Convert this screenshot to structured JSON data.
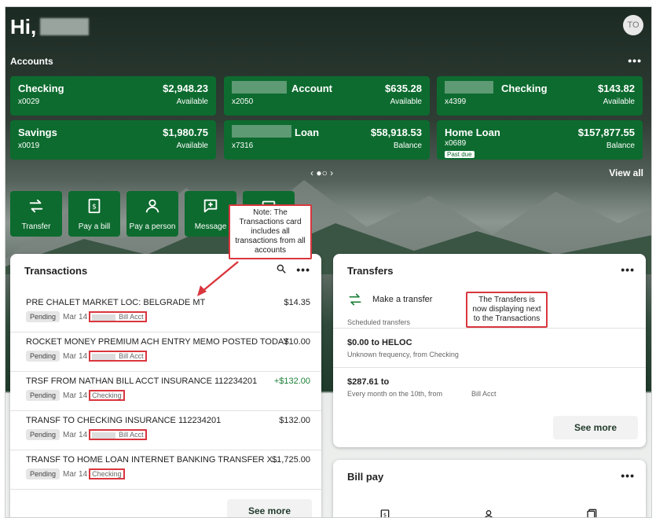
{
  "greeting": "Hi,",
  "avatar_initials": "TO",
  "accounts": {
    "label": "Accounts",
    "more": "•••",
    "items": [
      {
        "name": "Checking",
        "number": "x0029",
        "amount": "$2,948.23",
        "sub": "Available"
      },
      {
        "name": "Account",
        "number": "x2050",
        "amount": "$635.28",
        "sub": "Available"
      },
      {
        "name": "Checking",
        "number": "x4399",
        "amount": "$143.82",
        "sub": "Available"
      },
      {
        "name": "Savings",
        "number": "x0019",
        "amount": "$1,980.75",
        "sub": "Available"
      },
      {
        "name": "Loan",
        "number": "x7316",
        "amount": "$58,918.53",
        "sub": "Balance"
      },
      {
        "name": "Home Loan",
        "number": "x0689",
        "amount": "$157,877.55",
        "sub": "Balance",
        "badge": "Past due"
      }
    ],
    "pager": "‹ ●○ ›",
    "view_all": "View all"
  },
  "quick_actions": [
    {
      "label": "Transfer",
      "icon": "transfer-icon"
    },
    {
      "label": "Pay a bill",
      "icon": "bill-icon"
    },
    {
      "label": "Pay a person",
      "icon": "person-icon"
    },
    {
      "label": "Message",
      "icon": "message-icon"
    },
    {
      "label": "",
      "icon": "deposit-icon"
    }
  ],
  "transactions": {
    "title": "Transactions",
    "more": "•••",
    "items": [
      {
        "desc": "PRE CHALET MARKET LOC: BELGRADE MT",
        "amount": "$14.35",
        "status": "Pending",
        "date": "Mar 14",
        "account": "Bill Acct"
      },
      {
        "desc": "ROCKET MONEY PREMIUM ACH ENTRY MEMO POSTED TODAY",
        "amount": "$10.00",
        "status": "Pending",
        "date": "Mar 14",
        "account": "Bill Acct"
      },
      {
        "desc": "TRSF FROM NATHAN BILL ACCT INSURANCE 112234201",
        "amount": "+$132.00",
        "status": "Pending",
        "date": "Mar 14",
        "account": "Checking"
      },
      {
        "desc": "TRANSF TO CHECKING INSURANCE 112234201",
        "amount": "$132.00",
        "status": "Pending",
        "date": "Mar 14",
        "account": "Bill Acct"
      },
      {
        "desc": "TRANSF TO HOME LOAN INTERNET BANKING TRANSFER X...",
        "amount": "$1,725.00",
        "status": "Pending",
        "date": "Mar 14",
        "account": "Checking"
      }
    ],
    "see_more": "See more"
  },
  "transfers": {
    "title": "Transfers",
    "more": "•••",
    "make_transfer": "Make a transfer",
    "scheduled_label": "Scheduled transfers",
    "items": [
      {
        "main": "$0.00 to HELOC",
        "sub": "Unknown frequency, from Checking"
      },
      {
        "main": "$287.61 to",
        "sub": "Every month on the 10th, from",
        "sub2": "Bill Acct"
      }
    ],
    "see_more": "See more"
  },
  "billpay": {
    "title": "Bill pay",
    "more": "•••"
  },
  "callouts": {
    "transactions_note": "Note: The Transactions card includes all transactions from all accounts",
    "transfers_note": "The Transfers is now displaying next to the Transactions"
  },
  "colors": {
    "brand_green": "#0d6b2f",
    "highlight_red": "#d9363e",
    "positive_green": "#1a7f37"
  }
}
